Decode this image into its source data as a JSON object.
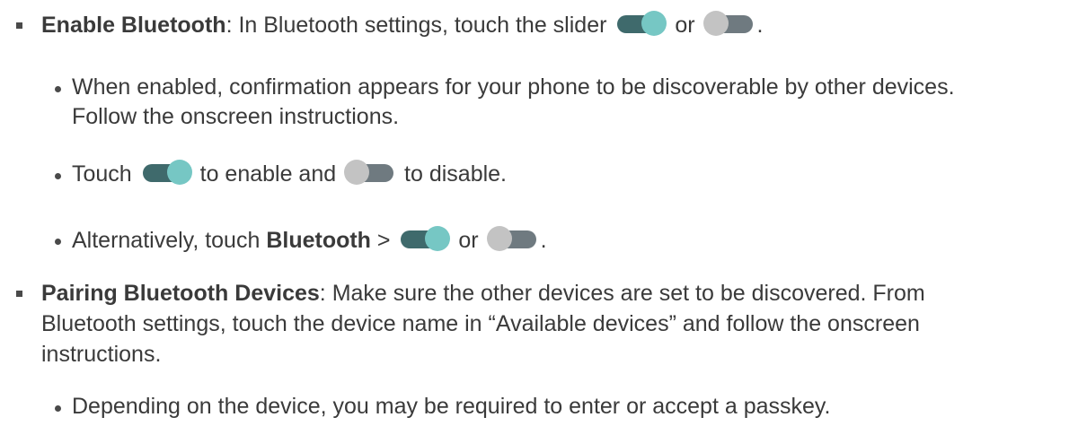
{
  "items": {
    "enable": {
      "title": "Enable Bluetooth",
      "text_before": ": In Bluetooth settings, touch the slider ",
      "or": " or ",
      "end": "."
    },
    "enable_sub1": {
      "line1": "When enabled, confirmation appears for your phone to be discoverable by other devices.",
      "line2": "Follow the onscreen instructions."
    },
    "enable_sub2": {
      "before": "Touch ",
      "middle": " to enable and ",
      "after": " to disable."
    },
    "enable_sub3": {
      "before": "Alternatively, touch ",
      "bold": "Bluetooth",
      "gt": " > ",
      "or": " or ",
      "end": "."
    },
    "pairing": {
      "title": "Pairing Bluetooth Devices",
      "line1_rest": ": Make sure the other devices are set to be discovered. From",
      "line2": "Bluetooth settings, touch the device name in “Available devices” and follow the onscreen",
      "line3": "instructions."
    },
    "pairing_sub1": {
      "text": "Depending on the device, you may be required to enter or accept a passkey."
    }
  },
  "colors": {
    "text": "#3a3a3a",
    "toggle_on_track": "#3f6a6c",
    "toggle_on_knob": "#76c7c4",
    "toggle_off_track": "#6f7a80",
    "toggle_off_knob": "#c3c3c3"
  },
  "icons": [
    "toggle-on-icon",
    "toggle-off-icon"
  ]
}
